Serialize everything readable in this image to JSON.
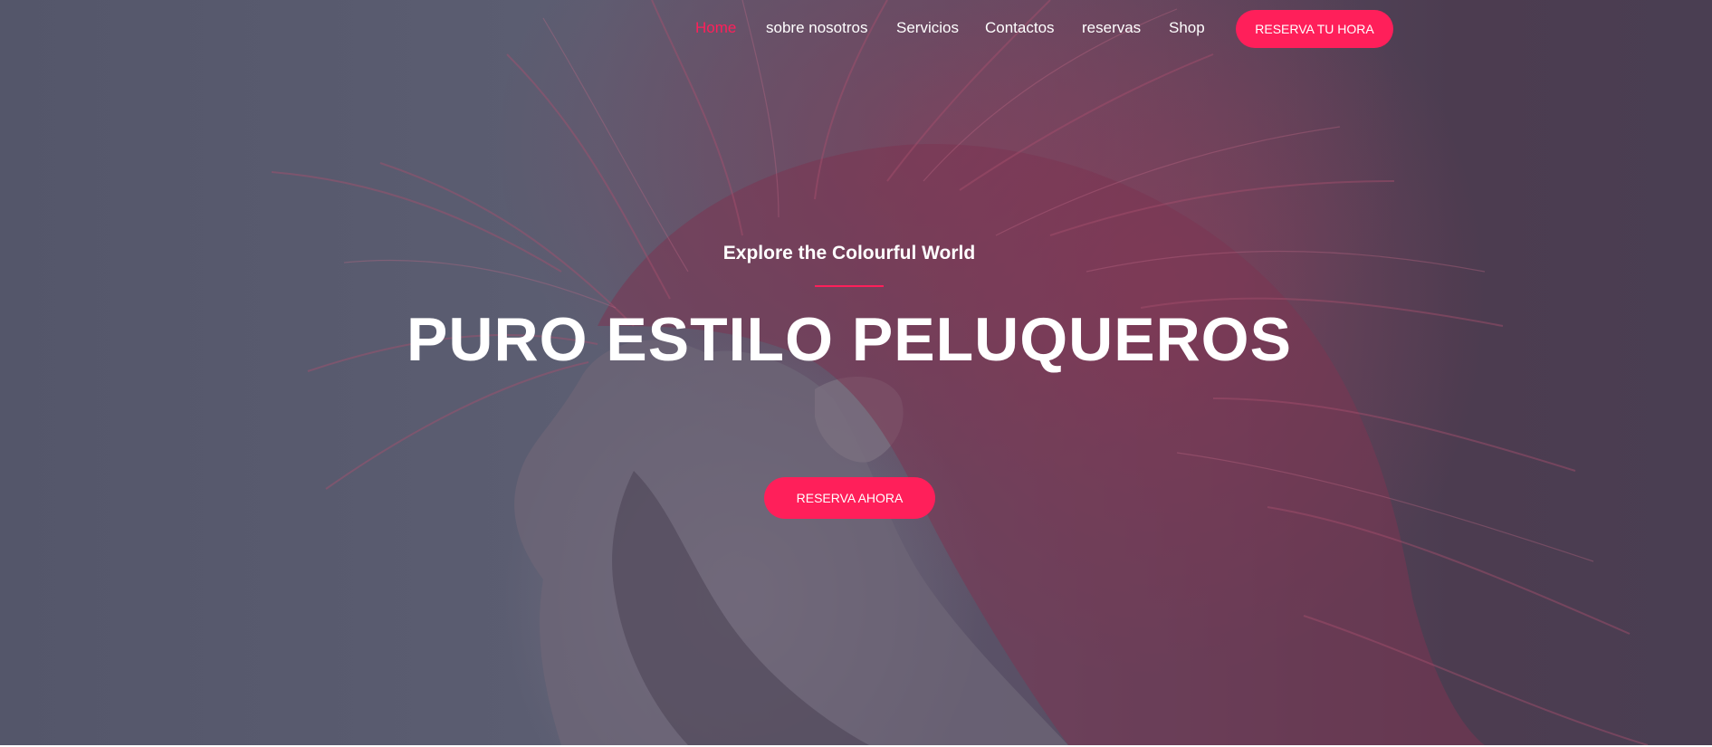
{
  "nav": {
    "items": [
      {
        "label": "Home",
        "active": true
      },
      {
        "label": "sobre nosotros",
        "active": false
      },
      {
        "label": "Servicios",
        "active": false
      },
      {
        "label": "Contactos",
        "active": false
      },
      {
        "label": "reservas",
        "active": false
      },
      {
        "label": "Shop",
        "active": false
      }
    ],
    "cta_label": "RESERVA TU HORA"
  },
  "hero": {
    "subtitle": "Explore the Colourful World",
    "title": "PURO ESTILO PELUQUEROS",
    "cta_label": "RESERVA AHORA",
    "background_image": "woman-with-flying-pink-hair"
  },
  "colors": {
    "accent": "#ff1f5a",
    "text": "#ffffff",
    "overlay": "#5a5c70"
  }
}
